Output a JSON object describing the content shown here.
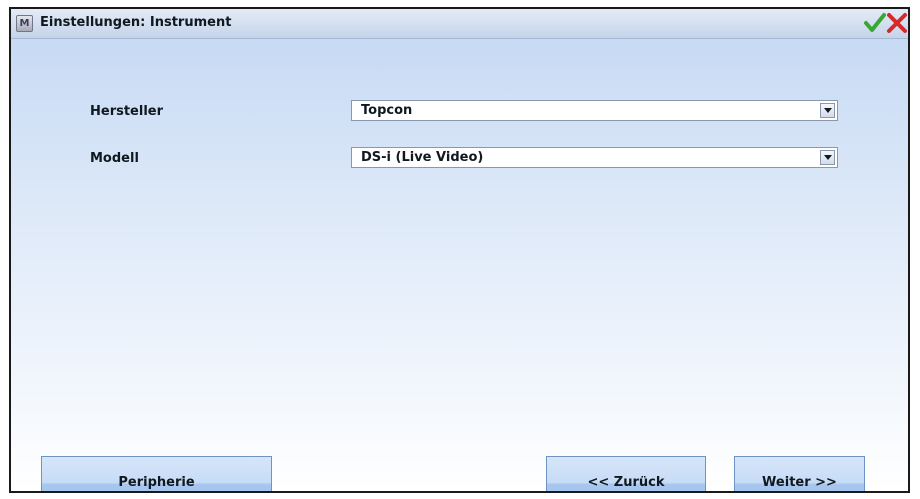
{
  "window": {
    "title": "Einstellungen: Instrument",
    "app_icon_letter": "M",
    "ok_icon": "checkmark-icon",
    "cancel_icon": "close-icon"
  },
  "form": {
    "hersteller": {
      "label": "Hersteller",
      "selected": "Topcon"
    },
    "modell": {
      "label": "Modell",
      "selected": "DS-i (Live Video)"
    }
  },
  "buttons": {
    "peripherie": "Peripherie",
    "zurueck": "<< Zurück",
    "weiter": "Weiter >>"
  },
  "colors": {
    "ok_green": "#3aa635",
    "cancel_red": "#d42a2a",
    "button_blue": "#a6c6ef"
  }
}
